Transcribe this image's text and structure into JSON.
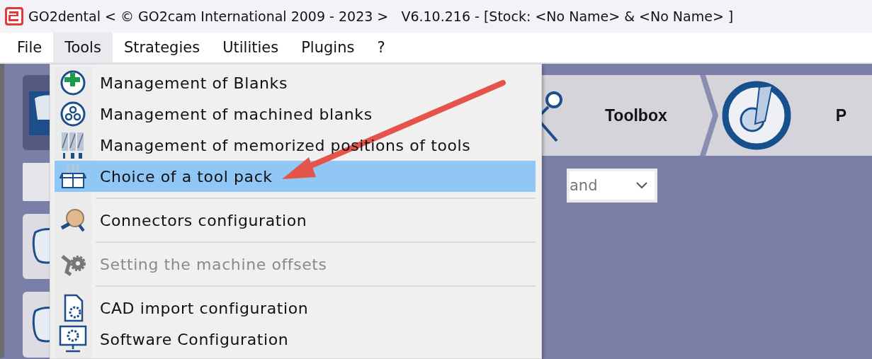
{
  "window": {
    "title": "GO2dental < © GO2cam International 2009 - 2023 >   V6.10.216 - [Stock: <No Name> & <No Name> ]"
  },
  "menu_bar": [
    {
      "label": "File",
      "selected": false
    },
    {
      "label": "Tools",
      "selected": true
    },
    {
      "label": "Strategies",
      "selected": false
    },
    {
      "label": "Utilities",
      "selected": false
    },
    {
      "label": "Plugins",
      "selected": false
    },
    {
      "label": "?",
      "selected": false
    }
  ],
  "toolbar": {
    "items": [
      {
        "label": "Toolbox"
      },
      {
        "label": "P"
      }
    ]
  },
  "filter": {
    "value": "and"
  },
  "tools_menu": {
    "items": [
      {
        "kind": "item",
        "label": "Management of Blanks",
        "disabled": false,
        "selected": false
      },
      {
        "kind": "item",
        "label": "Management of machined blanks",
        "disabled": false,
        "selected": false
      },
      {
        "kind": "item",
        "label": "Management of memorized positions of tools",
        "disabled": false,
        "selected": false
      },
      {
        "kind": "item",
        "label": "Choice of a tool pack",
        "disabled": false,
        "selected": true
      },
      {
        "kind": "separator"
      },
      {
        "kind": "item",
        "label": "Connectors configuration",
        "disabled": false,
        "selected": false
      },
      {
        "kind": "separator"
      },
      {
        "kind": "item",
        "label": "Setting the machine offsets",
        "disabled": true,
        "selected": false
      },
      {
        "kind": "separator"
      },
      {
        "kind": "item",
        "label": "CAD import configuration",
        "disabled": false,
        "selected": false
      },
      {
        "kind": "item",
        "label": "Software Configuration",
        "disabled": false,
        "selected": false
      }
    ]
  }
}
